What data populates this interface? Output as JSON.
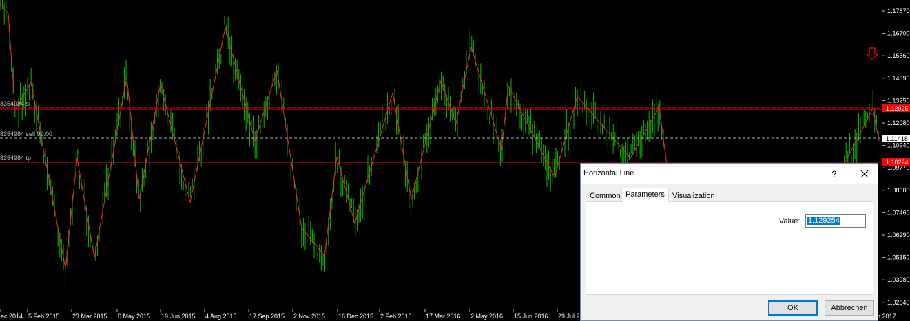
{
  "chart": {
    "background": "#000000",
    "price_axis": [
      "1.17870",
      "1.16700",
      "1.15560",
      "1.14390",
      "1.13250",
      "1.12080",
      "1.10940",
      "1.09770",
      "1.08600",
      "1.07460",
      "1.06290",
      "1.05150",
      "1.03980",
      "1.02840"
    ],
    "date_axis": [
      "ec 2014",
      "5 Feb 2015",
      "23 Mar 2015",
      "6 May 2015",
      "19 Jun 2015",
      "4 Aug 2015",
      "17 Sep 2015",
      "2 Nov 2015",
      "16 Dec 2015",
      "2 Feb 2016",
      "17 Mar 2016",
      "2 May 2016",
      "15 Jun 2016",
      "29 Jul 2",
      "n 2017"
    ],
    "price_tags": {
      "upper_red": "1.12925",
      "current": "1.11418",
      "lower_red": "1.10224"
    },
    "level_labels": {
      "upper": "8354984 sl",
      "middle": "8354984 sell 90.00",
      "lower": "8354984 tp"
    },
    "colors": {
      "bars": "#00c000",
      "zigzag": "#ff2020",
      "sl_line": "#ff0000",
      "entry_line": "#a0b4b4",
      "arrow": "#ff0000"
    }
  },
  "dialog": {
    "title": "Horizontal Line",
    "help": "?",
    "close_icon": "close-icon",
    "tabs": [
      "Common",
      "Parameters",
      "Visualization"
    ],
    "active_tab": "Parameters",
    "value_label": "Value:",
    "value": "1.129254",
    "ok_label": "OK",
    "cancel_label": "Abbrechen"
  }
}
